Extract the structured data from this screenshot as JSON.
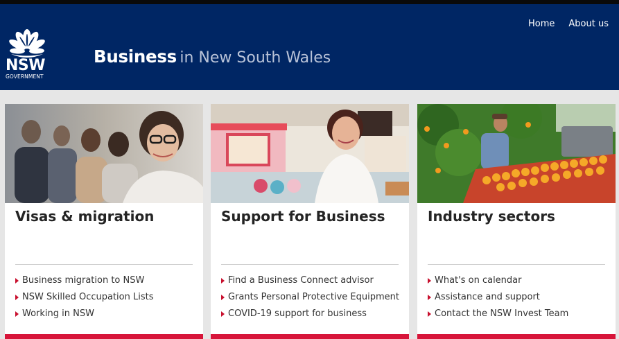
{
  "header": {
    "logo": {
      "wordmark": "NSW",
      "subtitle": "GOVERNMENT"
    },
    "title_strong": "Business",
    "title_light": "in New South Wales",
    "nav": [
      {
        "label": "Home"
      },
      {
        "label": "About us"
      }
    ]
  },
  "cards": [
    {
      "title": "Visas & migration",
      "links": [
        "Business migration to NSW",
        "NSW Skilled Occupation Lists",
        "Working in NSW"
      ]
    },
    {
      "title": "Support for Business",
      "links": [
        "Find a Business Connect advisor",
        "Grants Personal Protective Equipment",
        "COVID-19 support for business"
      ]
    },
    {
      "title": "Industry sectors",
      "links": [
        "What's on calendar",
        "Assistance and support",
        "Contact the NSW Invest Team"
      ]
    }
  ],
  "colors": {
    "header_bg": "#002664",
    "accent": "#d7153a",
    "page_bg": "#e6e6e6"
  }
}
